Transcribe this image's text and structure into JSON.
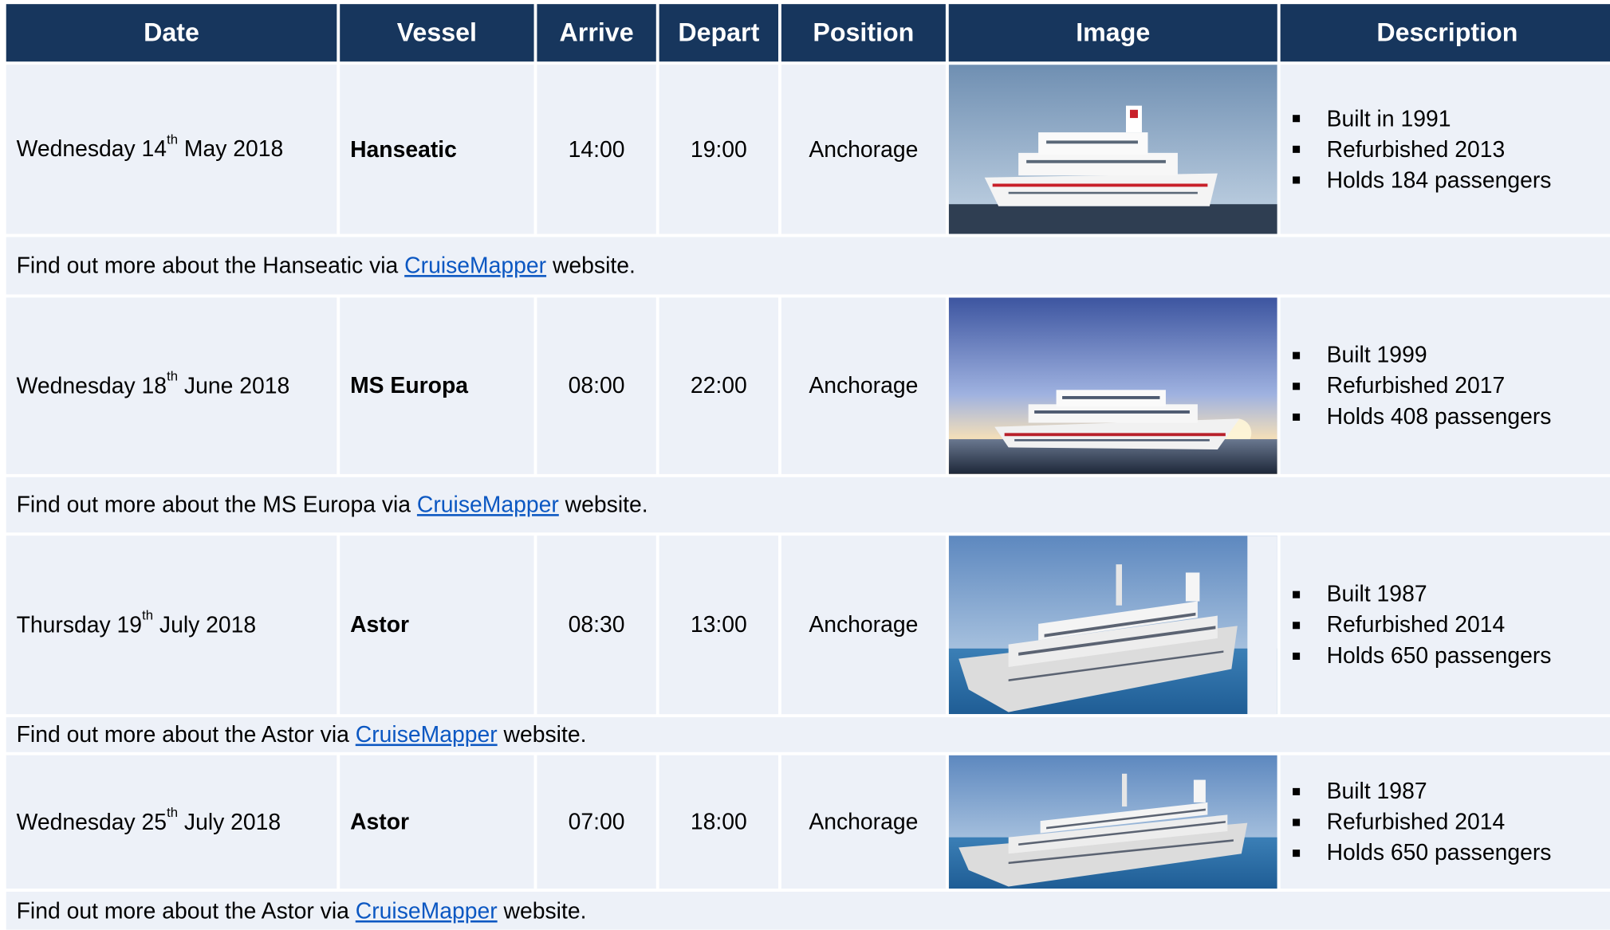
{
  "headers": [
    "Date",
    "Vessel",
    "Arrive",
    "Depart",
    "Position",
    "Image",
    "Description"
  ],
  "rows": [
    {
      "date_pre": "Wednesday 14",
      "date_sup": "th",
      "date_post": " May 2018",
      "vessel": "Hanseatic",
      "arrive": "14:00",
      "depart": "19:00",
      "position": "Anchorage",
      "image_alt": "Hanseatic ship photo",
      "desc": [
        "Built in 1991",
        "Refurbished 2013",
        "Holds 184 passengers"
      ],
      "note_pre": "Find out more about the Hanseatic via ",
      "link": "CruiseMapper",
      "note_post": " website."
    },
    {
      "date_pre": "Wednesday 18",
      "date_sup": "th",
      "date_post": " June 2018",
      "vessel": "MS Europa",
      "arrive": "08:00",
      "depart": "22:00",
      "position": "Anchorage",
      "image_alt": "MS Europa ship photo",
      "desc": [
        "Built 1999",
        "Refurbished 2017",
        "Holds 408 passengers"
      ],
      "note_pre": "Find out more about the MS Europa via ",
      "link": "CruiseMapper",
      "note_post": " website."
    },
    {
      "date_pre": "Thursday 19",
      "date_sup": "th",
      "date_post": " July 2018",
      "vessel": "Astor",
      "arrive": "08:30",
      "depart": "13:00",
      "position": "Anchorage",
      "image_alt": "Astor ship photo",
      "desc": [
        "Built 1987",
        "Refurbished 2014",
        "Holds 650 passengers"
      ],
      "note_pre": "Find out more about the Astor via ",
      "link": "CruiseMapper",
      "note_post": " website."
    },
    {
      "date_pre": "Wednesday 25",
      "date_sup": "th",
      "date_post": " July 2018",
      "vessel": "Astor",
      "arrive": "07:00",
      "depart": "18:00",
      "position": "Anchorage",
      "image_alt": "Astor ship photo",
      "desc": [
        "Built 1987",
        "Refurbished 2014",
        "Holds 650 passengers"
      ],
      "note_pre": "Find out more about the Astor via ",
      "link": "CruiseMapper",
      "note_post": " website."
    }
  ],
  "colors": {
    "header_bg": "#17365d",
    "header_text": "#ffffff",
    "row_bg": "#edf1f8",
    "link": "#0b57c2"
  }
}
